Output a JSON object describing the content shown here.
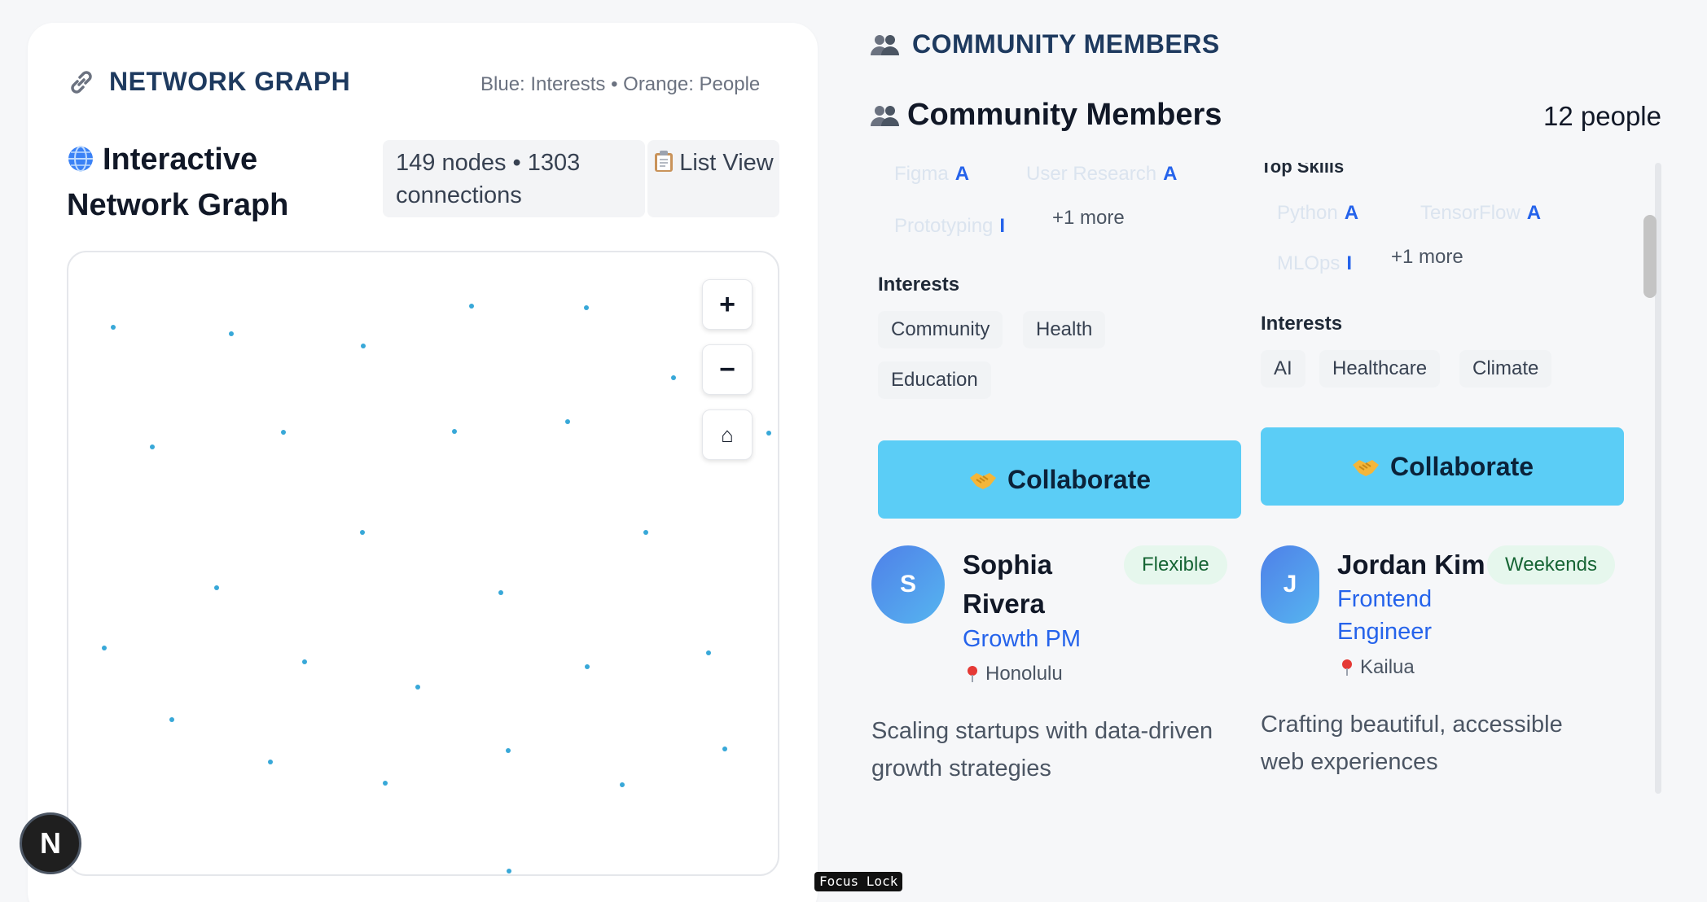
{
  "network": {
    "section_title": "NETWORK GRAPH",
    "legend": "Blue: Interests • Orange: People",
    "subtitle": "Interactive Network Graph",
    "stats": "149 nodes • 1303 connections",
    "list_view_label": "List View",
    "zoom_in_label": "+",
    "zoom_out_label": "−",
    "home_label": "⌂",
    "node_color": "#38a8d8"
  },
  "community": {
    "section_title": "COMMUNITY MEMBERS",
    "title": "Community Members",
    "count": "12 people",
    "members": [
      {
        "top_skills_faded": [
          {
            "name": "Figma",
            "level": "A"
          },
          {
            "name": "User Research",
            "level": "A"
          },
          {
            "name": "Prototyping",
            "level": "I"
          }
        ],
        "more": "+1 more",
        "interests_label": "Interests",
        "interests": [
          "Community",
          "Health",
          "Education"
        ],
        "collab_label": "Collaborate"
      },
      {
        "top_skills_label": "Top Skills",
        "top_skills_faded": [
          {
            "name": "Python",
            "level": "A"
          },
          {
            "name": "TensorFlow",
            "level": "A"
          },
          {
            "name": "MLOps",
            "level": "I"
          }
        ],
        "more": "+1 more",
        "interests_label": "Interests",
        "interests": [
          "AI",
          "Healthcare",
          "Climate"
        ],
        "collab_label": "Collaborate"
      }
    ],
    "people": [
      {
        "initial": "S",
        "name": "Sophia Rivera",
        "role": "Growth PM",
        "location": "Honolulu",
        "availability": "Flexible",
        "bio": "Scaling startups with data-driven growth strategies"
      },
      {
        "initial": "J",
        "name": "Jordan Kim",
        "role": "Frontend Engineer",
        "location": "Kailua",
        "availability": "Weekends",
        "bio": "Crafting beautiful, accessible web experiences"
      }
    ]
  },
  "footer": {
    "logo_letter": "N",
    "focus_lock": "Focus Lock"
  }
}
